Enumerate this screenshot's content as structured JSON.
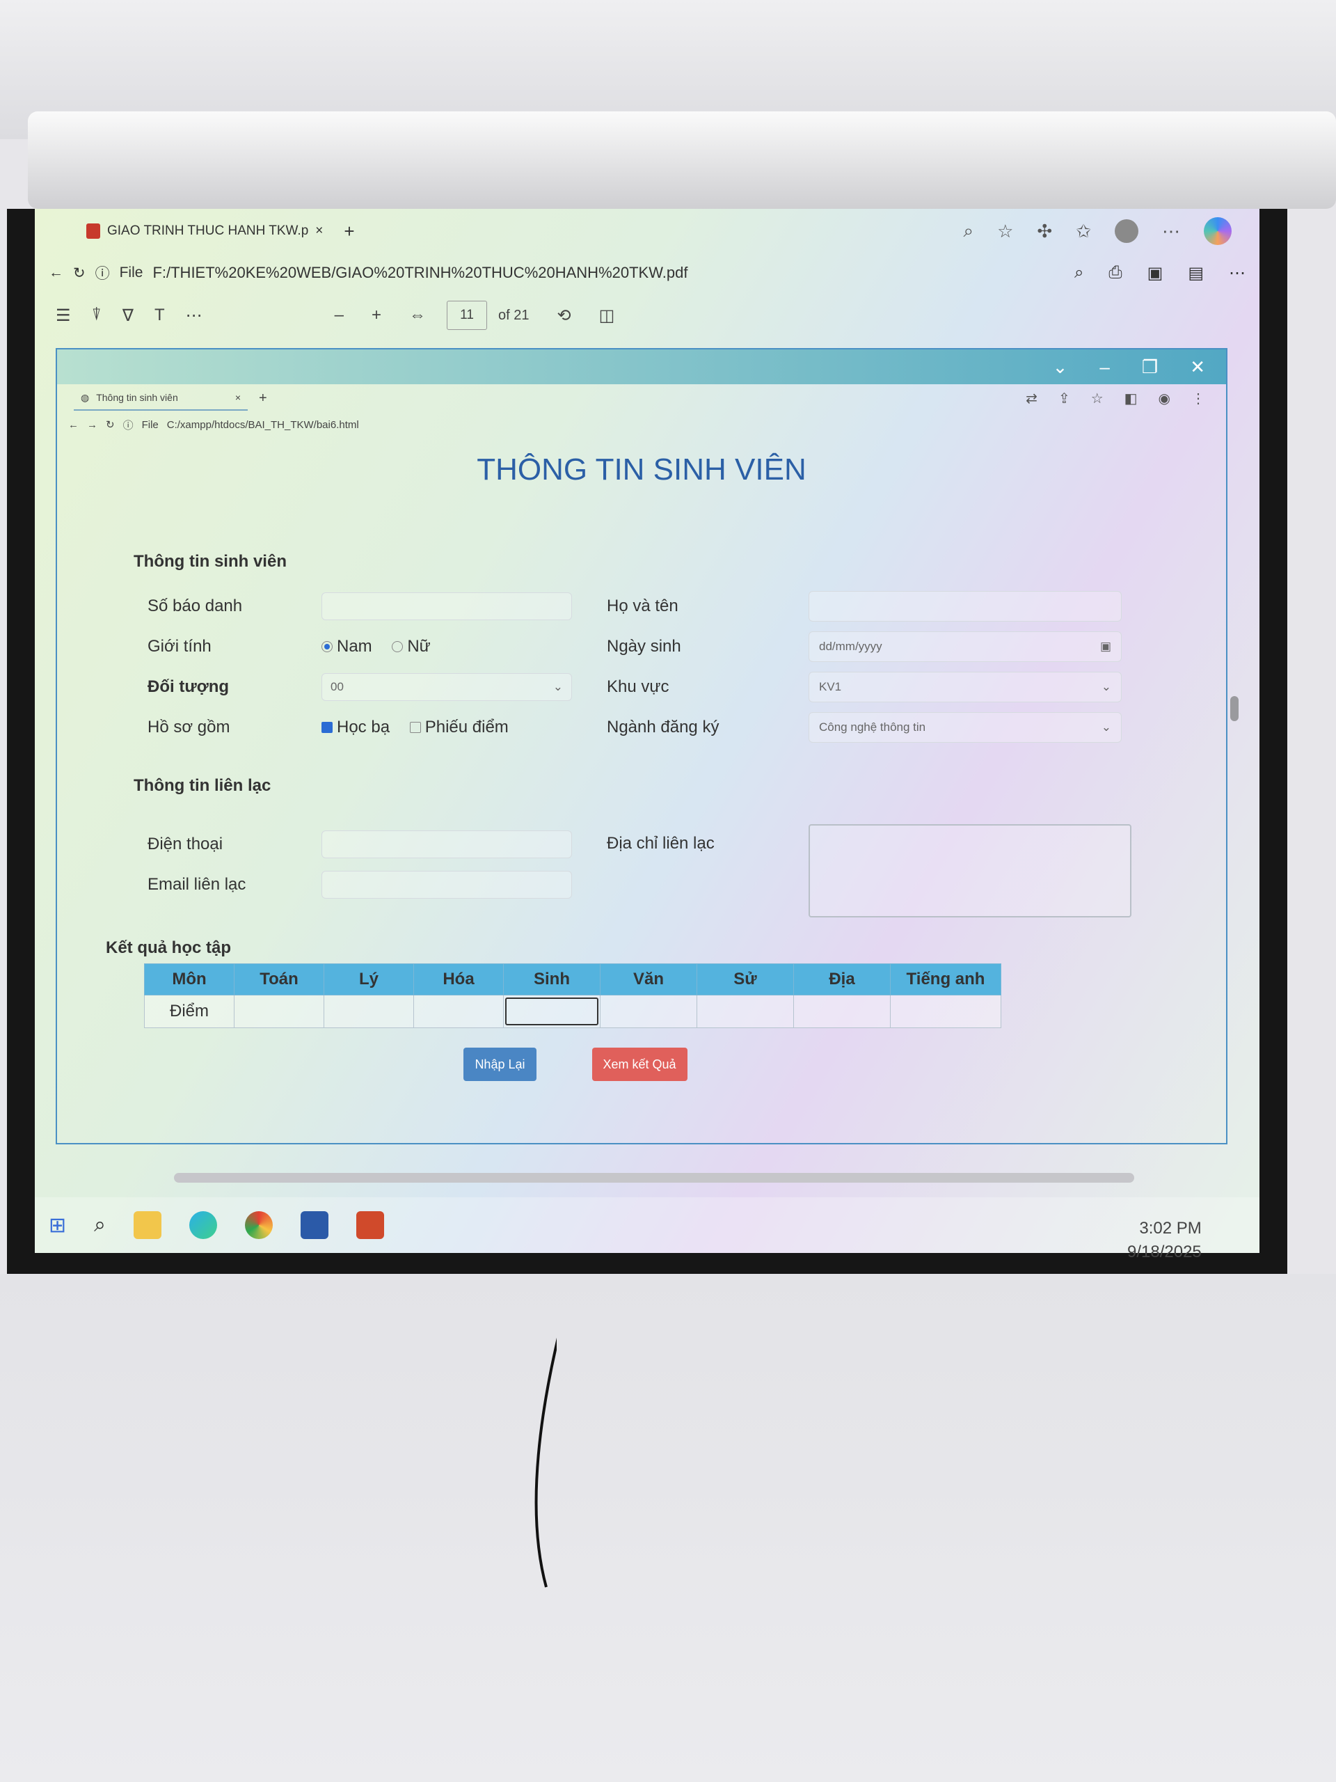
{
  "pdf_viewer": {
    "tab_title": "GIAO TRINH THUC HANH TKW.p",
    "tab_close": "×",
    "new_tab": "+",
    "address_prefix": "File",
    "address_url": "F:/THIET%20KE%20WEB/GIAO%20TRINH%20THUC%20HANH%20TKW.pdf",
    "zoom_out": "–",
    "zoom_in": "+",
    "current_page": "11",
    "page_total": "of 21"
  },
  "inner_browser": {
    "tab_title": "Thông tin sinh viên",
    "tab_close": "×",
    "new_tab": "+",
    "address_prefix": "File",
    "address_url": "C:/xampp/htdocs/BAI_TH_TKW/bai6.html"
  },
  "form": {
    "page_title": "THÔNG TIN SINH VIÊN",
    "section_student": "Thông tin sinh viên",
    "label_so_bao_danh": "Số báo danh",
    "label_ho_ten": "Họ và tên",
    "label_gioi_tinh": "Giới tính",
    "gender_options": [
      "Nam",
      "Nữ"
    ],
    "gender_selected": "Nam",
    "label_ngay_sinh": "Ngày sinh",
    "ngay_sinh_placeholder": "dd/mm/yyyy",
    "label_doi_tuong": "Đối tượng",
    "doi_tuong_value": "00",
    "label_khu_vuc": "Khu vực",
    "khu_vuc_value": "KV1",
    "label_ho_so": "Hồ sơ gồm",
    "ho_so_options": [
      "Học bạ",
      "Phiếu điểm"
    ],
    "ho_so_checked": "Học bạ",
    "label_nganh": "Ngành đăng ký",
    "nganh_value": "Công nghệ thông tin",
    "section_contact": "Thông tin liên lạc",
    "label_dien_thoai": "Điện thoại",
    "label_dia_chi": "Địa chỉ liên lạc",
    "label_email": "Email liên lạc",
    "section_results": "Kết quả học tập",
    "table_headers": [
      "Môn",
      "Toán",
      "Lý",
      "Hóa",
      "Sinh",
      "Văn",
      "Sử",
      "Địa",
      "Tiếng anh"
    ],
    "row_label": "Điểm",
    "btn_reset": "Nhập Lại",
    "btn_submit": "Xem kết Quả"
  },
  "taskbar": {
    "time": "3:02 PM",
    "date": "9/18/2025"
  },
  "colors": {
    "title_blue": "#2b5fa6",
    "table_header": "#54b3de",
    "btn_reset": "#4a86c4",
    "btn_submit": "#e0605b"
  }
}
